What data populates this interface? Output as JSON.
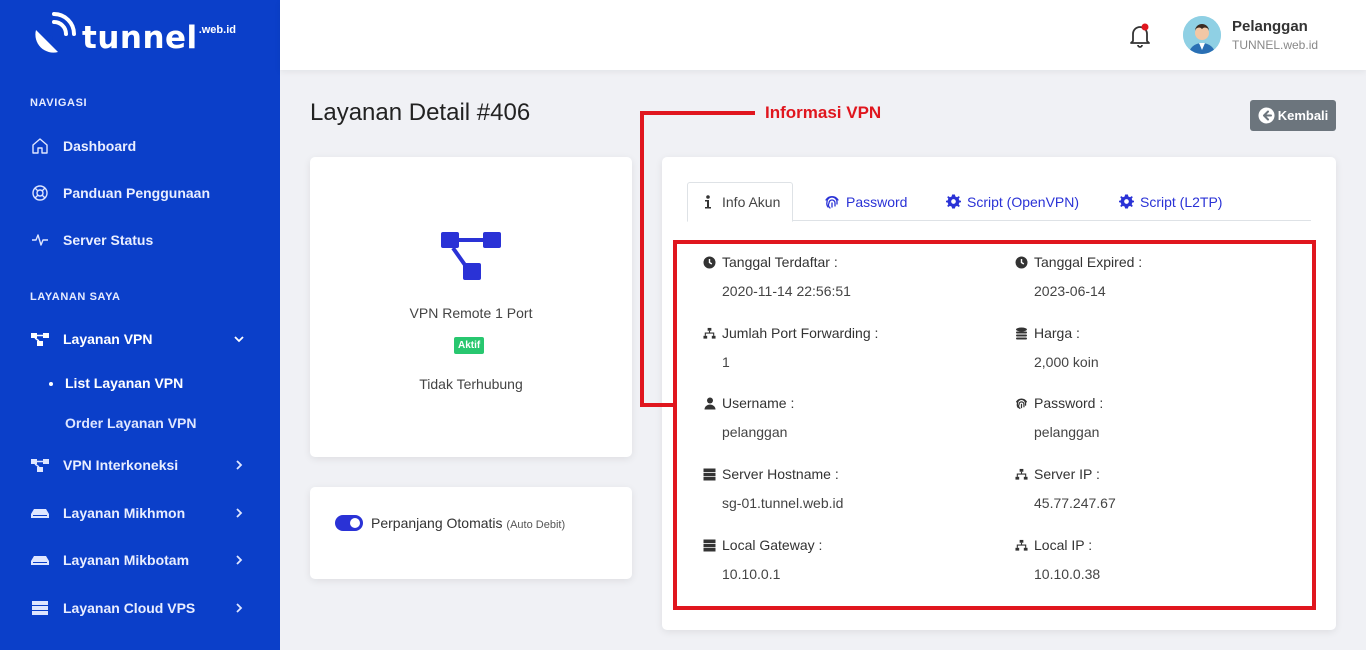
{
  "brand": {
    "name": "tunnel",
    "suffix": ".web.id"
  },
  "sidebar": {
    "navigasi_heading": "NAVIGASI",
    "layanan_heading": "LAYANAN SAYA",
    "items": [
      {
        "label": "Dashboard",
        "icon": "home-icon"
      },
      {
        "label": "Panduan Penggunaan",
        "icon": "lifebuoy-icon"
      },
      {
        "label": "Server Status",
        "icon": "activity-icon"
      },
      {
        "label": "Layanan VPN",
        "icon": "network-icon"
      },
      {
        "label": "VPN Interkoneksi",
        "icon": "network-icon"
      },
      {
        "label": "Layanan Mikhmon",
        "icon": "router-icon"
      },
      {
        "label": "Layanan Mikbotam",
        "icon": "router-icon"
      },
      {
        "label": "Layanan Cloud VPS",
        "icon": "server-icon"
      }
    ],
    "sub_items": [
      {
        "label": "List Layanan VPN",
        "active": true
      },
      {
        "label": "Order Layanan VPN",
        "active": false
      }
    ]
  },
  "topbar": {
    "user_name": "Pelanggan",
    "user_sub": "TUNNEL.web.id"
  },
  "page": {
    "title": "Layanan Detail #406",
    "back_label": "Kembali"
  },
  "annotation": {
    "text": "Informasi VPN",
    "color": "#e0161e"
  },
  "service": {
    "name": "VPN Remote 1 Port",
    "status_badge": "Aktif",
    "connection": "Tidak Terhubung"
  },
  "renew": {
    "label": "Perpanjang Otomatis",
    "note": "(Auto Debit)",
    "enabled": true
  },
  "tabs": [
    {
      "label": "Info Akun",
      "icon": "info-icon",
      "active": true
    },
    {
      "label": "Password",
      "icon": "fingerprint-icon",
      "active": false
    },
    {
      "label": "Script (OpenVPN)",
      "icon": "gear-icon",
      "active": false
    },
    {
      "label": "Script (L2TP)",
      "icon": "gear-icon",
      "active": false
    }
  ],
  "fields": [
    {
      "label": "Tanggal Terdaftar :",
      "value": "2020-11-14 22:56:51",
      "icon": "clock-icon"
    },
    {
      "label": "Tanggal Expired :",
      "value": "2023-06-14",
      "icon": "clock-icon"
    },
    {
      "label": "Jumlah Port Forwarding :",
      "value": "1",
      "icon": "sitemap-icon"
    },
    {
      "label": "Harga :",
      "value": "2,000 koin",
      "icon": "coins-icon"
    },
    {
      "label": "Username :",
      "value": "pelanggan",
      "icon": "user-icon"
    },
    {
      "label": "Password :",
      "value": "pelanggan",
      "icon": "fingerprint-icon"
    },
    {
      "label": "Server Hostname :",
      "value": "sg-01.tunnel.web.id",
      "icon": "server-icon"
    },
    {
      "label": "Server IP :",
      "value": "45.77.247.67",
      "icon": "sitemap-icon"
    },
    {
      "label": "Local Gateway :",
      "value": "10.10.0.1",
      "icon": "server-icon"
    },
    {
      "label": "Local IP :",
      "value": "10.10.0.38",
      "icon": "sitemap-icon"
    }
  ],
  "colors": {
    "sidebar": "#0b3fc9",
    "accent": "#2a32d6",
    "success": "#28c76f",
    "annotation": "#e0161e"
  }
}
